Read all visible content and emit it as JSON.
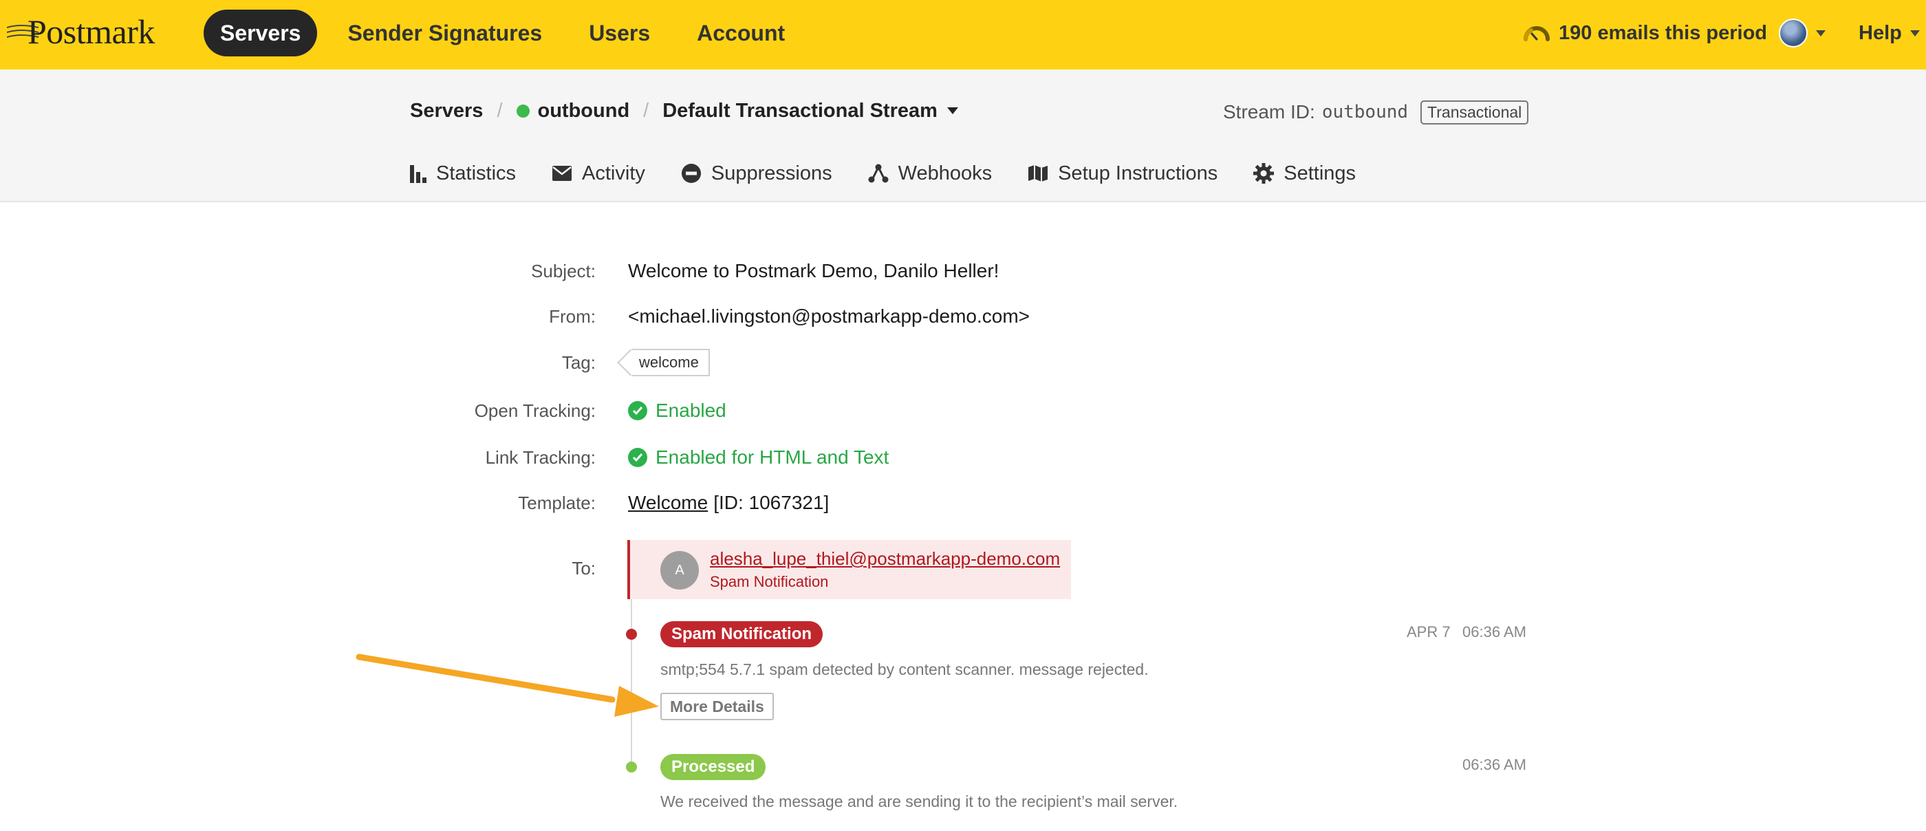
{
  "brand": {
    "name": "Postmark",
    "accent": "#fed213"
  },
  "nav": {
    "items": [
      {
        "label": "Servers",
        "active": true
      },
      {
        "label": "Sender Signatures",
        "active": false
      },
      {
        "label": "Users",
        "active": false
      },
      {
        "label": "Account",
        "active": false
      }
    ],
    "usage_icon": "gauge-icon",
    "usage_text": "190 emails this period",
    "help_label": "Help"
  },
  "breadcrumb": {
    "root": "Servers",
    "server": "outbound",
    "server_status_color": "#3cba4b",
    "stream": "Default Transactional Stream"
  },
  "stream_info": {
    "label": "Stream ID:",
    "id": "outbound",
    "type": "Transactional"
  },
  "tabs": [
    {
      "label": "Statistics",
      "icon": "bar-chart-icon"
    },
    {
      "label": "Activity",
      "icon": "envelope-icon"
    },
    {
      "label": "Suppressions",
      "icon": "minus-circle-icon"
    },
    {
      "label": "Webhooks",
      "icon": "webhook-icon"
    },
    {
      "label": "Setup Instructions",
      "icon": "map-icon"
    },
    {
      "label": "Settings",
      "icon": "gear-icon"
    }
  ],
  "message": {
    "subject_label": "Subject:",
    "subject": "Welcome to Postmark Demo, Danilo Heller!",
    "from_label": "From:",
    "from": "<michael.livingston@postmarkapp-demo.com>",
    "tag_label": "Tag:",
    "tag": "welcome",
    "open_tracking_label": "Open Tracking:",
    "open_tracking": "Enabled",
    "link_tracking_label": "Link Tracking:",
    "link_tracking": "Enabled for HTML and Text",
    "template_label": "Template:",
    "template_name": "Welcome",
    "template_id": "[ID: 1067321]",
    "to_label": "To:"
  },
  "recipient": {
    "initial": "A",
    "email": "alesha_lupe_thiel@postmarkapp-demo.com",
    "status": "Spam Notification"
  },
  "events": [
    {
      "badge": "Spam Notification",
      "color": "#c0272d",
      "date": "APR 7",
      "time": "06:36 AM",
      "detail": "smtp;554 5.7.1 spam detected by content scanner. message rejected.",
      "button": "More Details"
    },
    {
      "badge": "Processed",
      "color": "#8cc84b",
      "time": "06:36 AM",
      "detail": "We received the message and are sending it to the recipient’s mail server."
    }
  ],
  "annotation": {
    "color": "#f5a623"
  }
}
